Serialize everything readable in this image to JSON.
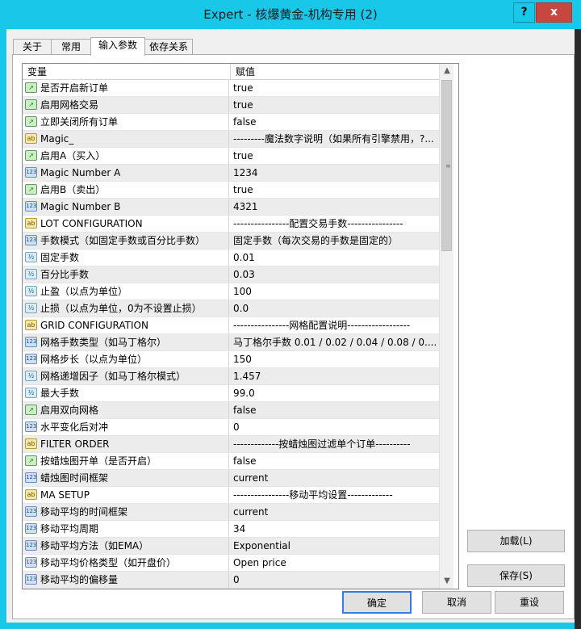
{
  "window": {
    "title": "Expert - 核爆黄金-机构专用 (2)",
    "help_label": "?",
    "close_label": "x"
  },
  "tabs": [
    {
      "label": "关于"
    },
    {
      "label": "常用"
    },
    {
      "label": "输入参数"
    },
    {
      "label": "依存关系"
    }
  ],
  "grid": {
    "col_variable": "变量",
    "col_value": "赋值",
    "rows": [
      {
        "type": "bool",
        "name": "是否开启新订单",
        "value": "true"
      },
      {
        "type": "bool",
        "name": "启用网格交易",
        "value": "true"
      },
      {
        "type": "bool",
        "name": "立即关闭所有订单",
        "value": "false"
      },
      {
        "type": "string",
        "name": "Magic_",
        "value": "---------魔法数字说明（如果所有引擎禁用，?..."
      },
      {
        "type": "bool",
        "name": "启用A（买入）",
        "value": "true"
      },
      {
        "type": "int",
        "name": "Magic Number  A",
        "value": "1234"
      },
      {
        "type": "bool",
        "name": "启用B（卖出）",
        "value": "true"
      },
      {
        "type": "int",
        "name": "Magic Number  B",
        "value": "4321"
      },
      {
        "type": "string",
        "name": "LOT CONFIGURATION",
        "value": "----------------配置交易手数----------------"
      },
      {
        "type": "int",
        "name": "手数模式（如固定手数或百分比手数）",
        "value": "固定手数（每次交易的手数是固定的）"
      },
      {
        "type": "double",
        "name": "固定手数",
        "value": "0.01"
      },
      {
        "type": "double",
        "name": "百分比手数",
        "value": "0.03"
      },
      {
        "type": "double",
        "name": "止盈（以点为单位）",
        "value": "100"
      },
      {
        "type": "double",
        "name": "止损（以点为单位，0为不设置止损）",
        "value": "0.0"
      },
      {
        "type": "string",
        "name": "GRID CONFIGURATION",
        "value": "----------------网格配置说明------------------"
      },
      {
        "type": "int",
        "name": "网格手数类型（如马丁格尔）",
        "value": "马丁格尔手数  0.01 / 0.02 / 0.04 / 0.08 / 0...."
      },
      {
        "type": "int",
        "name": "网格步长（以点为单位）",
        "value": "150"
      },
      {
        "type": "double",
        "name": "网格递增因子（如马丁格尔模式）",
        "value": "1.457"
      },
      {
        "type": "double",
        "name": "最大手数",
        "value": "99.0"
      },
      {
        "type": "bool",
        "name": "启用双向网格",
        "value": "false"
      },
      {
        "type": "int",
        "name": "水平变化后对冲",
        "value": "0"
      },
      {
        "type": "string",
        "name": "FILTER ORDER",
        "value": "-------------按蜡烛图过滤单个订单----------"
      },
      {
        "type": "bool",
        "name": "按蜡烛图开单（是否开启）",
        "value": "false"
      },
      {
        "type": "int",
        "name": "蜡烛图时间框架",
        "value": "current"
      },
      {
        "type": "string",
        "name": "MA SETUP",
        "value": "----------------移动平均设置-------------"
      },
      {
        "type": "int",
        "name": "移动平均的时间框架",
        "value": "current"
      },
      {
        "type": "int",
        "name": "移动平均周期",
        "value": "34"
      },
      {
        "type": "int",
        "name": "移动平均方法（如EMA）",
        "value": "Exponential"
      },
      {
        "type": "int",
        "name": "移动平均价格类型（如开盘价）",
        "value": "Open price"
      },
      {
        "type": "int",
        "name": "移动平均的偏移量",
        "value": "0"
      }
    ]
  },
  "buttons": {
    "load": "加载(L)",
    "save": "保存(S)",
    "ok": "确定",
    "cancel": "取消",
    "reset": "重设"
  },
  "icons": {
    "bool": "chart-line-icon",
    "string": "ab-icon",
    "int": "123-icon",
    "double": "half-icon"
  }
}
